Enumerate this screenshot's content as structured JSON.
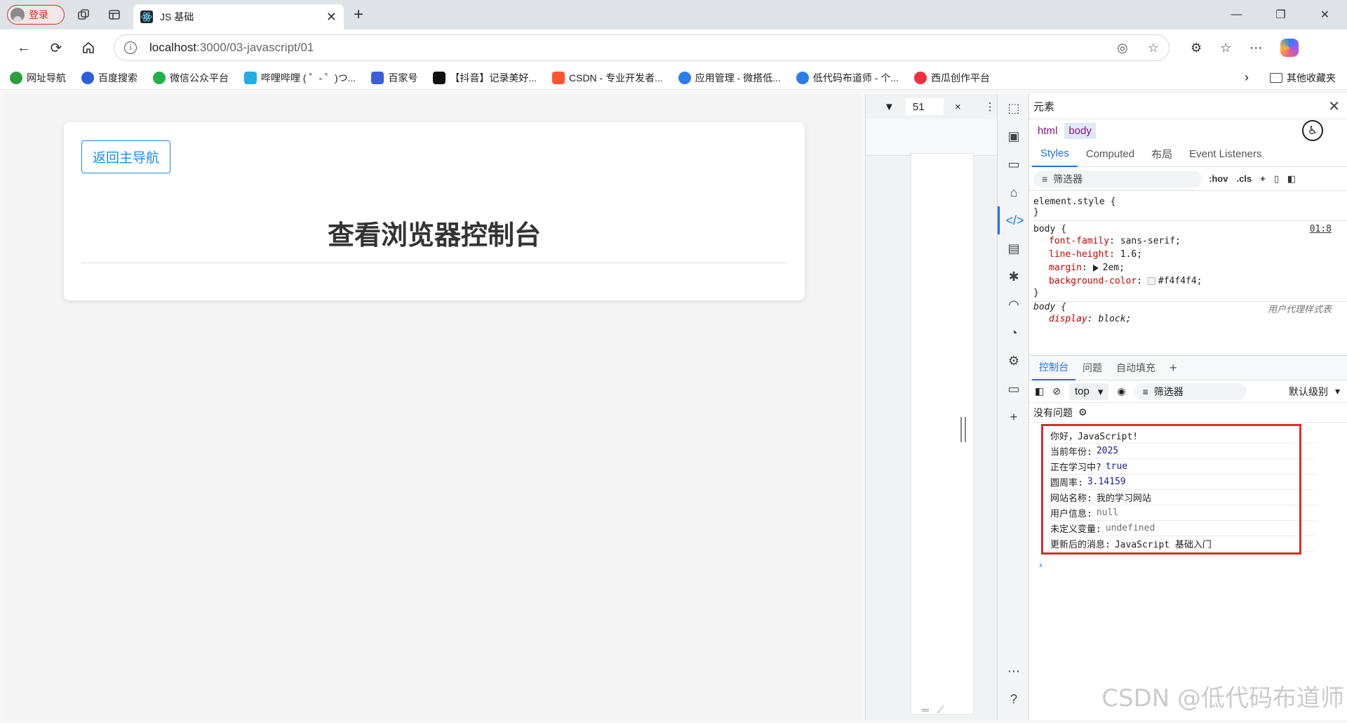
{
  "browser": {
    "login_label": "登录",
    "tab_title": "JS 基础",
    "url_host": "localhost",
    "url_path": ":3000/03-javascript/01",
    "bookmarks": [
      {
        "label": "网址导航",
        "color": "#2e9e3f"
      },
      {
        "label": "百度搜索",
        "color": "#2b5fd9"
      },
      {
        "label": "微信公众平台",
        "color": "#22b14c"
      },
      {
        "label": "哔哩哔哩 ( ゜- ゜)つ...",
        "color": "#23ade5"
      },
      {
        "label": "百家号",
        "color": "#3a5fd8"
      },
      {
        "label": "【抖音】记录美好...",
        "color": "#111111"
      },
      {
        "label": "CSDN - 专业开发者...",
        "color": "#fc5531"
      },
      {
        "label": "应用管理 - 微搭低...",
        "color": "#2b7de9"
      },
      {
        "label": "低代码布道师 - 个...",
        "color": "#2b7de9"
      },
      {
        "label": "西瓜创作平台",
        "color": "#f0303f"
      }
    ],
    "other_bookmarks": "其他收藏夹"
  },
  "page": {
    "back_button": "返回主导航",
    "title": "查看浏览器控制台"
  },
  "device_toolbar": {
    "width_value": "51"
  },
  "devtools": {
    "panel_title": "元素",
    "breadcrumbs": [
      "html",
      "body"
    ],
    "subtabs": [
      "Styles",
      "Computed",
      "布局",
      "Event Listeners"
    ],
    "styles_filter": "筛选器",
    "hov": ":hov",
    "cls": ".cls",
    "element_style": "element.style {",
    "close_brace": "}",
    "body_selector": "body {",
    "body_source": "01:8",
    "decls": [
      {
        "name": "font-family",
        "value": "sans-serif;"
      },
      {
        "name": "line-height",
        "value": "1.6;"
      },
      {
        "name": "margin",
        "value": "2em;"
      },
      {
        "name": "background-color",
        "value": "#f4f4f4;"
      }
    ],
    "ua_selector": "body {",
    "ua_source": "用户代理样式表",
    "ua_decl_name": "display",
    "ua_decl_value": "block;",
    "drawer_tabs": [
      "控制台",
      "问题",
      "自动填充"
    ],
    "context": "top",
    "console_filter": "筛选器",
    "level": "默认级别",
    "no_issues": "没有问题",
    "logs": [
      {
        "text": "你好，JavaScript!",
        "value": "",
        "kind": "str"
      },
      {
        "text": "当前年份:",
        "value": "2025",
        "kind": "num"
      },
      {
        "text": "正在学习中?",
        "value": "true",
        "kind": "bool"
      },
      {
        "text": "圆周率:",
        "value": "3.14159",
        "kind": "num"
      },
      {
        "text": "网站名称:",
        "value": "我的学习网站",
        "kind": "str"
      },
      {
        "text": "用户信息:",
        "value": "null",
        "kind": "null"
      },
      {
        "text": "未定义变量:",
        "value": "undefined",
        "kind": "null"
      },
      {
        "text": "更新后的消息:",
        "value": "JavaScript 基础入门",
        "kind": "str"
      }
    ],
    "prompt": "›"
  },
  "watermark": "CSDN @低代码布道师"
}
